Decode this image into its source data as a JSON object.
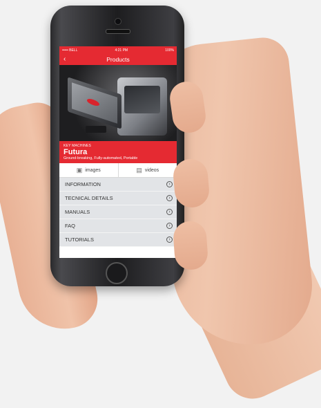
{
  "status_bar": {
    "carrier": "••••• BELL",
    "time": "4:21 PM",
    "battery": "100%"
  },
  "nav": {
    "title": "Products",
    "back_icon": "chevron-left-icon"
  },
  "product": {
    "brand": "KEY MACHINES",
    "name": "Futura",
    "tagline": "Ground-breaking, Fully-automated, Portable"
  },
  "media_tabs": [
    {
      "label": "images",
      "icon": "image-icon"
    },
    {
      "label": "videos",
      "icon": "video-icon"
    }
  ],
  "menu": [
    {
      "label": "INFORMATION"
    },
    {
      "label": "TECNICAL DETAILS"
    },
    {
      "label": "MANUALS"
    },
    {
      "label": "FAQ"
    },
    {
      "label": "TUTORIALS"
    }
  ],
  "colors": {
    "accent": "#e52a32",
    "menu_bg": "#e2e4e7"
  }
}
